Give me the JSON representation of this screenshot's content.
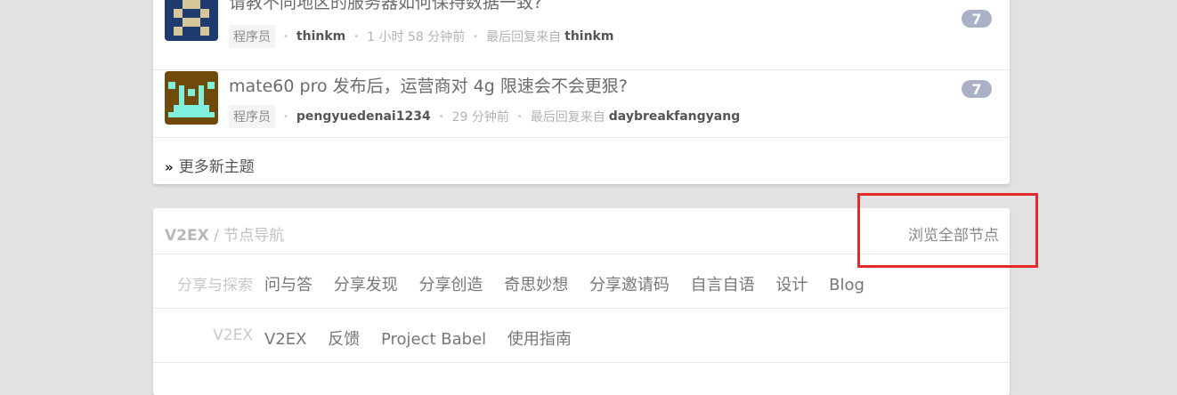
{
  "topics": [
    {
      "title": "请教不同地区的服务器如何保持数据一致?",
      "node": "程序员",
      "author": "thinkm",
      "time": "1 小时 58 分钟前",
      "last_reply_label": "最后回复来自",
      "last_reply_user": "thinkm",
      "reply_count": "7",
      "avatar_color": "#1e3a6e"
    },
    {
      "title": "mate60 pro 发布后，运营商对 4g 限速会不会更狠?",
      "node": "程序员",
      "author": "pengyuedenai1234",
      "time": "29 分钟前",
      "last_reply_label": "最后回复来自",
      "last_reply_user": "daybreakfangyang",
      "reply_count": "7",
      "avatar_color": "#6f4a0b"
    }
  ],
  "more": {
    "arrow": "»",
    "label": "更多新主题"
  },
  "nav": {
    "brand": "V2EX",
    "title": "/ 节点导航",
    "browse_all": "浏览全部节点",
    "rows": [
      {
        "category": "分享与探索",
        "links": [
          "问与答",
          "分享发现",
          "分享创造",
          "奇思妙想",
          "分享邀请码",
          "自言自语",
          "设计",
          "Blog"
        ]
      },
      {
        "category": "V2EX",
        "links": [
          "V2EX",
          "反馈",
          "Project Babel",
          "使用指南"
        ]
      }
    ]
  },
  "colors": {
    "highlight": "#e32b2b",
    "count_badge": "#aab0c6",
    "page_bg": "#e2e2e2"
  }
}
